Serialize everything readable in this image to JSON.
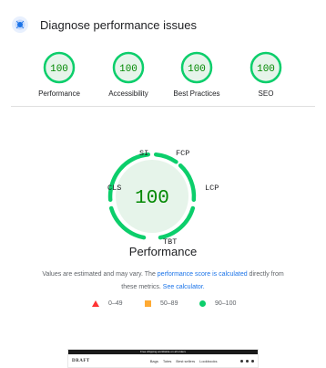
{
  "header": {
    "title": "Diagnose performance issues",
    "icon": "lighthouse-icon"
  },
  "scores": [
    {
      "value": "100",
      "label": "Performance"
    },
    {
      "value": "100",
      "label": "Accessibility"
    },
    {
      "value": "100",
      "label": "Best Practices"
    },
    {
      "value": "100",
      "label": "SEO"
    }
  ],
  "gauge": {
    "value": "100",
    "metrics": {
      "si": "SI",
      "fcp": "FCP",
      "cls": "CLS",
      "lcp": "LCP",
      "tbt": "TBT"
    }
  },
  "performance_title": "Performance",
  "note": {
    "prefix": "Values are estimated and may vary. The ",
    "link1": "performance score is calculated",
    "middle": " directly from these metrics. ",
    "link2": "See calculator."
  },
  "legend": [
    {
      "range": "0–49",
      "shape": "triangle",
      "color": "#ff3333"
    },
    {
      "range": "50–89",
      "shape": "square",
      "color": "#ffaa33"
    },
    {
      "range": "90–100",
      "shape": "circle",
      "color": "#0cce6b"
    }
  ],
  "thumbnail": {
    "banner": "Free shipping worldwide on all orders",
    "logo": "DRAFT",
    "links": [
      "Bags",
      "Totes",
      "Best sellers",
      "Lookbooks"
    ]
  },
  "colors": {
    "pass": "#0cce6b",
    "pass_text": "#008800",
    "pass_fill": "#e6f4ea",
    "link": "#1a73e8"
  }
}
